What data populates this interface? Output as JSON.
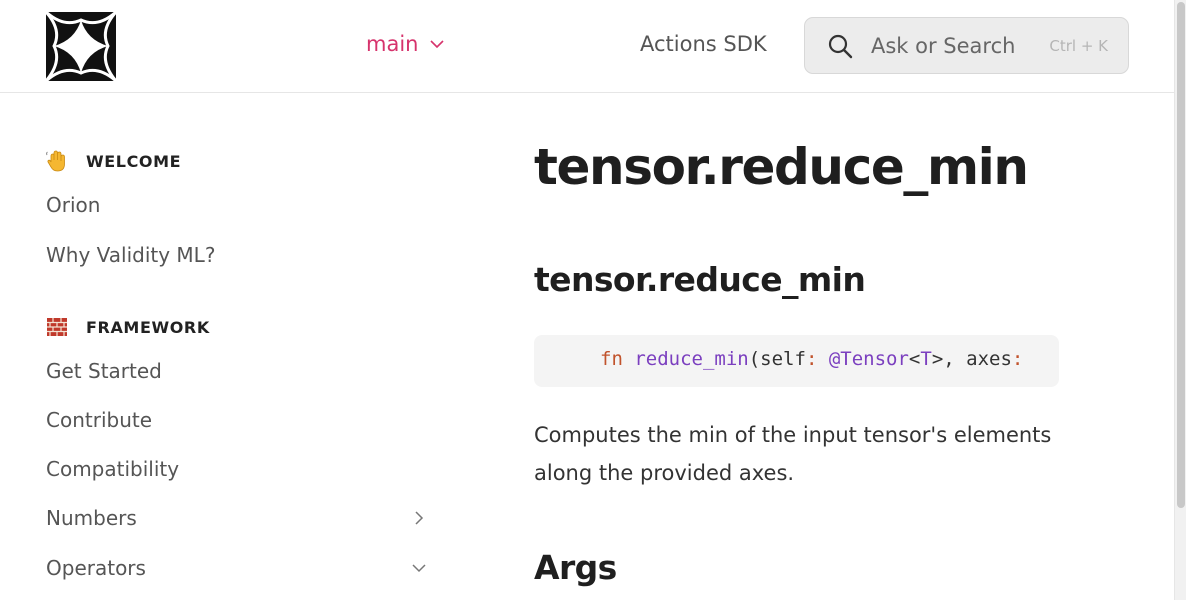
{
  "header": {
    "logo_name": "orion-logo",
    "branch_label": "main",
    "actions_link": "Actions SDK",
    "search": {
      "placeholder": "Ask or Search",
      "shortcut": "Ctrl + K"
    }
  },
  "sidebar": {
    "sections": [
      {
        "emoji": "waving-hand",
        "title": "WELCOME",
        "items": [
          {
            "label": "Orion"
          },
          {
            "label": "Why Validity ML?"
          }
        ]
      },
      {
        "emoji": "brick",
        "title": "FRAMEWORK",
        "items": [
          {
            "label": "Get Started"
          },
          {
            "label": "Contribute"
          },
          {
            "label": "Compatibility"
          },
          {
            "label": "Numbers",
            "arrow": "chevron-right"
          },
          {
            "label": "Operators",
            "arrow": "chevron-down"
          }
        ]
      }
    ]
  },
  "main": {
    "title": "tensor.reduce_min",
    "subtitle": "tensor.reduce_min",
    "code": {
      "kw": "fn",
      "fn_name": "reduce_min",
      "open": "(self",
      "colon1": ":",
      "at": "@Tensor",
      "lt": "<",
      "tparam": "T",
      "gt_sep": ">, axes",
      "colon2": ":"
    },
    "description": "Computes the min of the input tensor's elements along the provided axes.",
    "args_heading": "Args"
  },
  "colors": {
    "accent": "#d6336c",
    "keyword": "#c1532c",
    "identifier": "#7b3fbf"
  }
}
